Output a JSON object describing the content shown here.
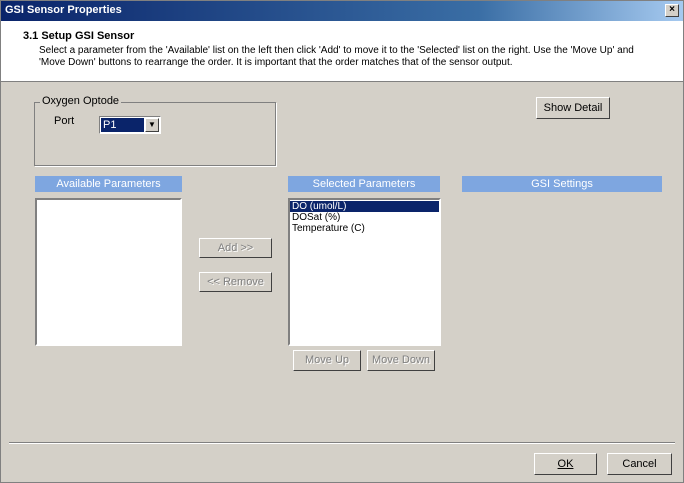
{
  "window": {
    "title": "GSI Sensor Properties",
    "close_glyph": "×"
  },
  "header": {
    "step_title": "3.1 Setup GSI Sensor",
    "description": "Select a parameter from the 'Available' list on the left then click 'Add' to move it to the 'Selected' list on the right.  Use the 'Move Up' and 'Move Down' buttons to rearrange the order.  It is important that the order matches that of the sensor output."
  },
  "oxygen_group": {
    "legend": "Oxygen Optode",
    "port_label": "Port",
    "port_value": "P1"
  },
  "buttons": {
    "show_detail": "Show Detail",
    "add": "Add >>",
    "remove": "<< Remove",
    "move_up": "Move Up",
    "move_down": "Move Down",
    "ok": "OK",
    "cancel": "Cancel"
  },
  "panels": {
    "available_title": "Available Parameters",
    "selected_title": "Selected Parameters",
    "settings_title": "GSI Settings"
  },
  "available_parameters": [],
  "selected_parameters": [
    {
      "label": "DO (umol/L)",
      "selected": true
    },
    {
      "label": "DOSat (%)",
      "selected": false
    },
    {
      "label": "Temperature (C)",
      "selected": false
    }
  ],
  "colors": {
    "title_bar": "#0a246a",
    "panel_header": "#7ea6e0",
    "selection": "#0a246a",
    "dialog_face": "#d4d0c8"
  },
  "icons": {
    "close": "close-icon",
    "dropdown": "chevron-down-icon"
  }
}
